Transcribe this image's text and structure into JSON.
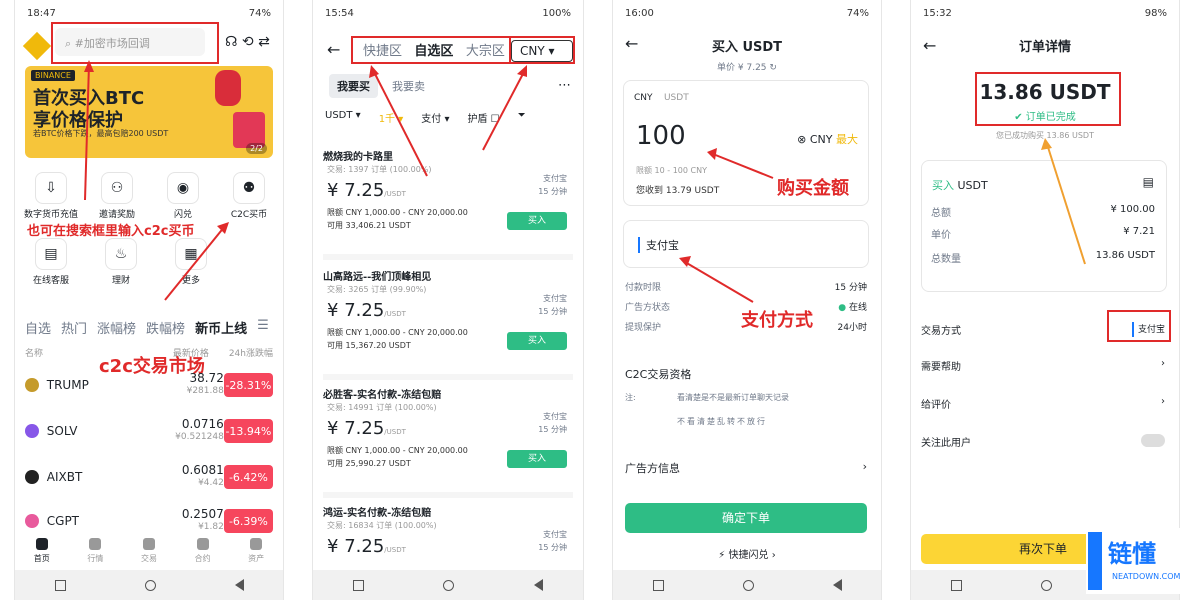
{
  "p1": {
    "time": "18:47",
    "battery": "74%",
    "search_placeholder": "#加密市场回调",
    "banner_brand": "BINANCE",
    "banner_line1": "首次买入BTC",
    "banner_line2": "享价格保护",
    "banner_line3": "若BTC价格下跌，最高包赔200 USDT",
    "banner_page": "2/2",
    "icons1": [
      "数字货币充值",
      "邀请奖励",
      "闪兑",
      "C2C买币"
    ],
    "icons2": [
      "在线客服",
      "理财",
      "更多"
    ],
    "tabs": [
      "自选",
      "热门",
      "涨幅榜",
      "跌幅榜",
      "新币上线"
    ],
    "col_name": "名称",
    "col_price": "最新价格",
    "col_change": "24h涨跌幅",
    "coins": [
      {
        "name": "TRUMP",
        "price": "38.72",
        "cny": "¥281.88",
        "change": "-28.31%"
      },
      {
        "name": "SOLV",
        "price": "0.0716",
        "cny": "¥0.521248",
        "change": "-13.94%"
      },
      {
        "name": "AIXBT",
        "price": "0.6081",
        "cny": "¥4.42",
        "change": "-6.42%"
      },
      {
        "name": "CGPT",
        "price": "0.2507",
        "cny": "¥1.82",
        "change": "-6.39%"
      }
    ],
    "nav": [
      "首页",
      "行情",
      "交易",
      "合约",
      "资产"
    ],
    "ann1": "也可在搜索框里输入c2c买币",
    "ann2": "c2c交易市场"
  },
  "p2": {
    "time": "15:54",
    "battery": "100%",
    "seg1": "快捷区",
    "seg2": "自选区",
    "seg3": "大宗区",
    "currency": "CNY",
    "buy": "我要买",
    "sell": "我要卖",
    "f1": "USDT",
    "f2": "1千",
    "f3": "支付",
    "f4": "护盾",
    "ads": [
      {
        "merchant": "燃烧我的卡路里",
        "trades": "交易: 1397 订单 (100.00%)",
        "price": "7.25",
        "unit": "/USDT",
        "limit": "限额   CNY 1,000.00 - CNY 20,000.00",
        "avail": "可用   33,406.21 USDT",
        "pay": "支付宝",
        "time": "15 分钟",
        "btn": "买入"
      },
      {
        "merchant": "山高路远--我们顶峰相见",
        "trades": "交易: 3265 订单 (99.90%)",
        "price": "7.25",
        "unit": "/USDT",
        "limit": "限额   CNY 1,000.00 - CNY 20,000.00",
        "avail": "可用   15,367.20 USDT",
        "pay": "支付宝",
        "time": "15 分钟",
        "btn": "买入"
      },
      {
        "merchant": "必胜客-实名付款-冻结包赔",
        "trades": "交易: 14991 订单 (100.00%)",
        "price": "7.25",
        "unit": "/USDT",
        "limit": "限额   CNY 1,000.00 - CNY 20,000.00",
        "avail": "可用   25,990.27 USDT",
        "pay": "支付宝",
        "time": "15 分钟",
        "btn": "买入"
      },
      {
        "merchant": "鸿运-实名付款-冻结包赔",
        "trades": "交易: 16834 订单 (100.00%)",
        "price": "7.25",
        "unit": "/USDT",
        "limit": "限额   CNY 1,000.00 - CNY 20,000.00",
        "avail": "",
        "pay": "支付宝",
        "time": "15 分钟",
        "btn": ""
      }
    ]
  },
  "p3": {
    "time": "16:00",
    "battery": "74%",
    "title": "买入 USDT",
    "unit_price": "单价 ¥ 7.25",
    "tab_cny": "CNY",
    "tab_usdt": "USDT",
    "amount": "100",
    "cur": "CNY",
    "max": "最大",
    "limit": "限额 10 - 100 CNY",
    "receive": "您收到 13.79 USDT",
    "pay_method": "支付宝",
    "pay_time_l": "付款时限",
    "pay_time_v": "15 分钟",
    "ad_status_l": "广告方状态",
    "ad_status_v": "在线",
    "protect_l": "提现保护",
    "protect_v": "24小时",
    "c2c": "C2C交易资格",
    "note_l": "注:",
    "note1": "看清楚是不是最新订单聊天记录",
    "note2": "不看清楚乱转不放行",
    "adv": "广告方信息",
    "confirm": "确定下单",
    "flash": "快捷闪兑",
    "ann1": "购买金额",
    "ann2": "支付方式"
  },
  "p4": {
    "time": "15:32",
    "battery": "98%",
    "title": "订单详情",
    "amount": "13.86 USDT",
    "done": "订单已完成",
    "success": "您已成功购买 13.86 USDT",
    "buy_label": "买入",
    "buy_coin": "USDT",
    "total_l": "总额",
    "total_v": "¥ 100.00",
    "price_l": "单价",
    "price_v": "¥ 7.21",
    "qty_l": "总数量",
    "qty_v": "13.86 USDT",
    "trade_l": "交易方式",
    "trade_v": "支付宝",
    "help": "需要帮助",
    "rate": "给评价",
    "follow": "关注此用户",
    "reorder": "再次下单"
  },
  "wm": {
    "cn": "链懂",
    "en": "NEATDOWN.COM"
  }
}
